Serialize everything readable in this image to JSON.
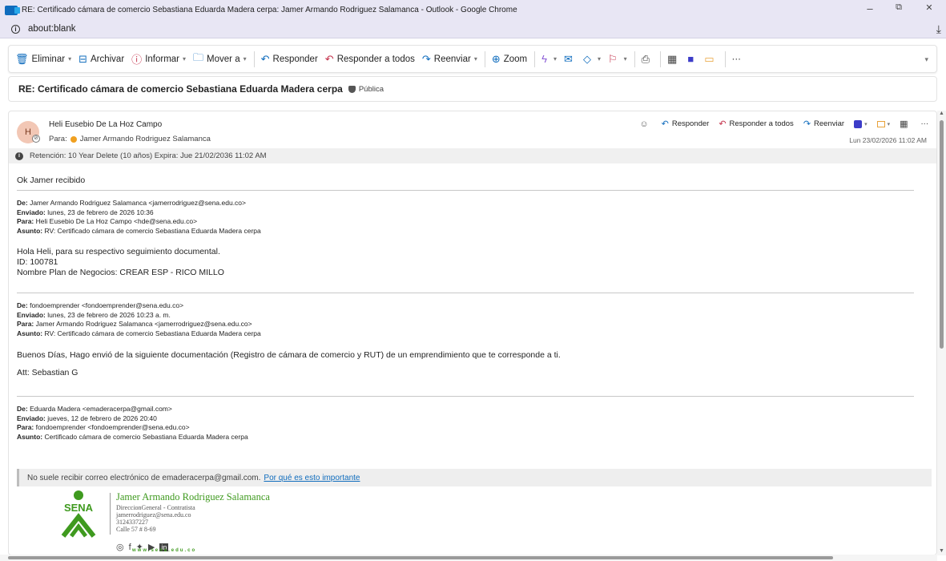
{
  "window": {
    "title": "RE: Certificado cámara de comercio Sebastiana Eduarda Madera cerpa: Jamer Armando Rodriguez Salamanca - Outlook - Google Chrome",
    "minimize": "–",
    "restore": "⧉",
    "close": "✕"
  },
  "address": {
    "url": "about:blank",
    "info": "i",
    "download": "⤓"
  },
  "toolbar": {
    "delete": "Eliminar",
    "archive": "Archivar",
    "report": "Informar",
    "move": "Mover a",
    "reply": "Responder",
    "reply_all": "Responder a todos",
    "forward": "Reenviar",
    "zoom": "Zoom",
    "more": "···"
  },
  "subject": {
    "text": "RE: Certificado cámara de comercio Sebastiana Eduarda Madera cerpa",
    "label": "Pública"
  },
  "message": {
    "avatar": "H",
    "sender": "Heli Eusebio De La Hoz Campo",
    "to_label": "Para:",
    "to": "Jamer Armando Rodriguez Salamanca",
    "reply": "Responder",
    "reply_all": "Responder a todos",
    "forward": "Reenviar",
    "more": "···",
    "datetime": "Lun 23/02/2026 11:02 AM",
    "retention": "Retención: 10 Year Delete (10 años) Expira: Jue 21/02/2036 11:02 AM"
  },
  "body": {
    "greeting": "Ok Jamer recibido",
    "fwd1": {
      "from_label": "De:",
      "from": "Jamer Armando Rodriguez Salamanca <jamerrodriguez@sena.edu.co>",
      "sent_label": "Enviado:",
      "sent": "lunes, 23 de febrero de 2026 10:36",
      "to_label": "Para:",
      "to": "Heli Eusebio De La Hoz Campo <hde@sena.edu.co>",
      "subject_label": "Asunto:",
      "subject": "RV: Certificado cámara de comercio Sebastiana Eduarda Madera cerpa"
    },
    "msg1_line1": "Hola Heli, para su respectivo seguimiento documental.",
    "msg1_line2": "ID: 100781",
    "msg1_line3": "Nombre Plan de Negocios: CREAR ESP - RICO MILLO",
    "fwd2": {
      "from_label": "De:",
      "from": "fondoemprender <fondoemprender@sena.edu.co>",
      "sent_label": "Enviado:",
      "sent": "lunes, 23 de febrero de 2026 10:23 a. m.",
      "to_label": "Para:",
      "to": "Jamer Armando Rodriguez Salamanca <jamerrodriguez@sena.edu.co>",
      "subject_label": "Asunto:",
      "subject": "RV: Certificado cámara de comercio Sebastiana Eduarda Madera cerpa"
    },
    "msg2_line1": "Buenos Días, Hago envió de la siguiente documentación (Registro de cámara de comercio y RUT) de un emprendimiento que te corresponde a ti.",
    "msg2_line2": "Att: Sebastian G",
    "fwd3": {
      "from_label": "De:",
      "from": "Eduarda Madera <emaderacerpa@gmail.com>",
      "sent_label": "Enviado:",
      "sent": "jueves, 12 de febrero de 2026 20:40",
      "to_label": "Para:",
      "to": "fondoemprender <fondoemprender@sena.edu.co>",
      "subject_label": "Asunto:",
      "subject": "Certificado cámara de comercio Sebastiana Eduarda Madera cerpa"
    },
    "safety_text": "No suele recibir correo electrónico de emaderacerpa@gmail.com.",
    "safety_link": "Por qué es esto importante"
  },
  "signature": {
    "logo_text": "SENA",
    "name": "Jamer Armando Rodriguez Salamanca",
    "role": "DireccionGeneral - Contratista",
    "email": "jamerrodriguez@sena.edu.co",
    "phone": "3124337227",
    "address": "Calle 57 # 8-69",
    "website": "www.sena.edu.co"
  },
  "colors": {
    "accent": "#0f6cbd",
    "sena_green": "#3f9a1f",
    "titlebar": "#e8e6f4"
  }
}
